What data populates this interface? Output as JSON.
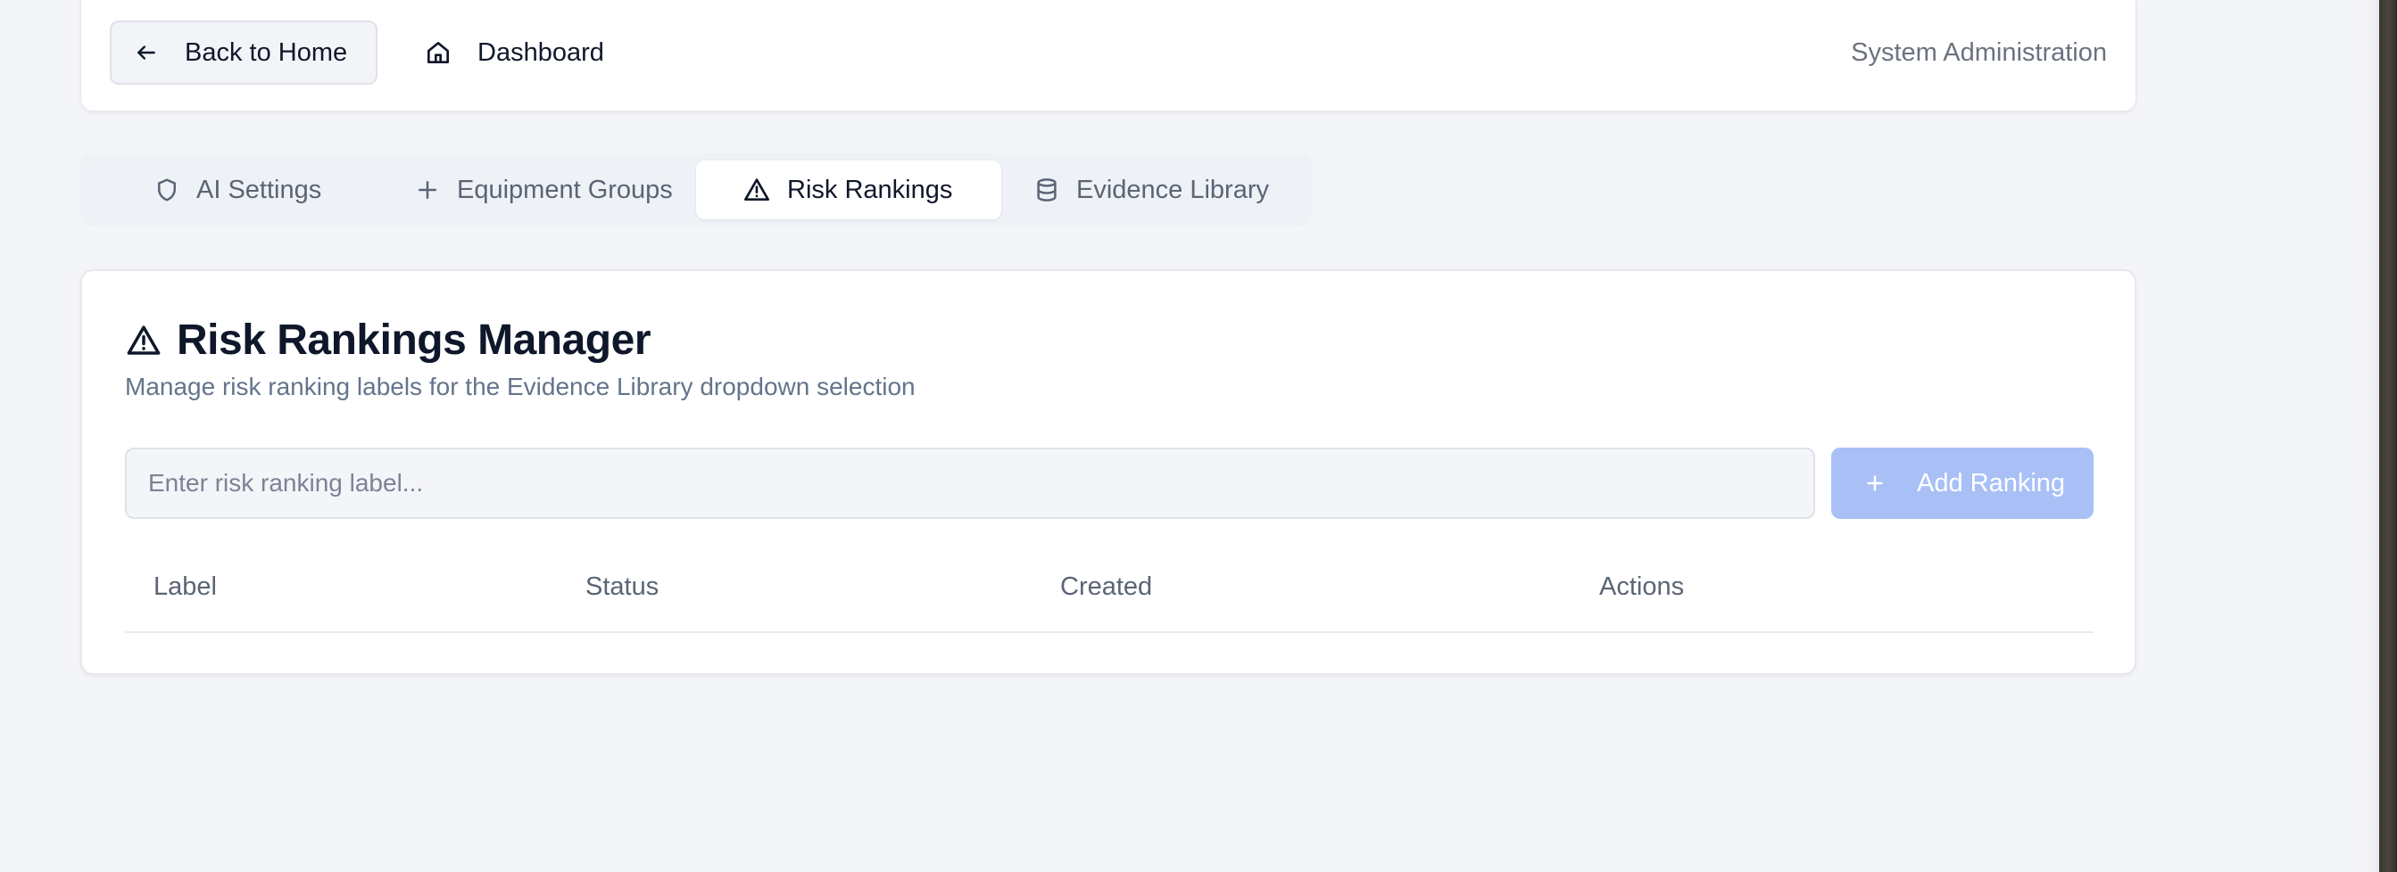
{
  "header": {
    "back_label": "Back to Home",
    "dashboard_label": "Dashboard",
    "section_label": "System Administration"
  },
  "tabs": [
    {
      "label": "AI Settings",
      "icon": "shield-icon",
      "active": false
    },
    {
      "label": "Equipment Groups",
      "icon": "plus-icon",
      "active": false
    },
    {
      "label": "Risk Rankings",
      "icon": "warning-triangle-icon",
      "active": true
    },
    {
      "label": "Evidence Library",
      "icon": "database-icon",
      "active": false
    }
  ],
  "manager": {
    "title": "Risk Rankings Manager",
    "description": "Manage risk ranking labels for the Evidence Library dropdown selection",
    "input_placeholder": "Enter risk ranking label...",
    "input_value": "",
    "add_label": "Add Ranking",
    "columns": [
      "Label",
      "Status",
      "Created",
      "Actions"
    ],
    "rows": []
  },
  "colors": {
    "accent_disabled": "#a8c0f6",
    "background": "#f4f5f9"
  }
}
